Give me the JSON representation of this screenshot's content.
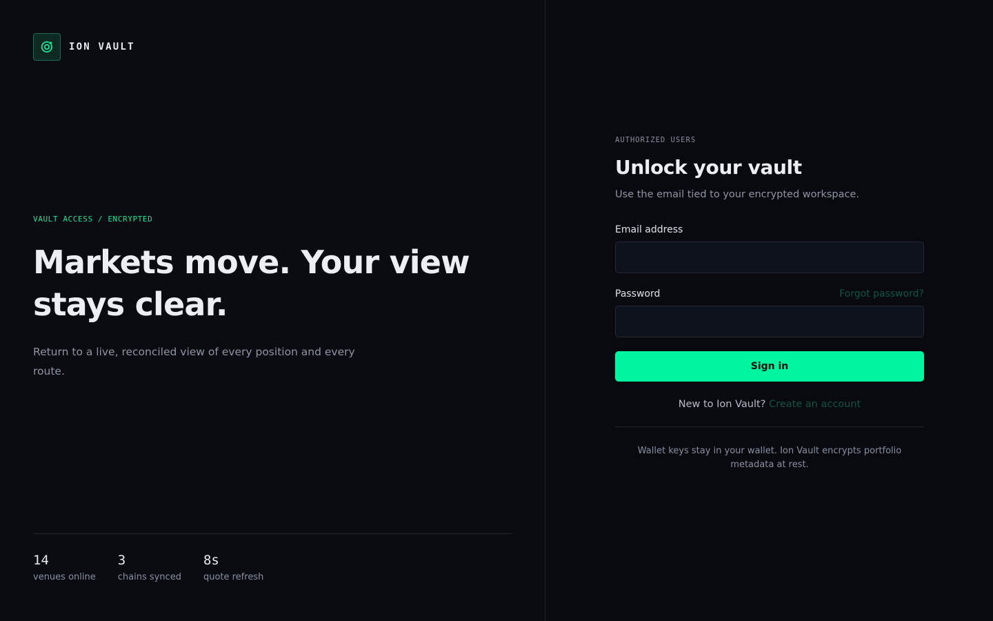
{
  "brand": {
    "name": "ION VAULT",
    "logo_icon": "atom-orbit-icon",
    "accent_color": "#00f5a0"
  },
  "hero": {
    "eyebrow": "VAULT ACCESS / ENCRYPTED",
    "headline": "Markets move. Your view stays clear.",
    "lead": "Return to a live, reconciled view of every position and every route."
  },
  "stats": [
    {
      "value": "14",
      "label": "venues online"
    },
    {
      "value": "3",
      "label": "chains synced"
    },
    {
      "value": "8s",
      "label": "quote refresh"
    }
  ],
  "form": {
    "kicker": "AUTHORIZED USERS",
    "title": "Unlock your vault",
    "subtitle": "Use the email tied to your encrypted workspace.",
    "email": {
      "label": "Email address",
      "value": "",
      "placeholder": ""
    },
    "password": {
      "label": "Password",
      "value": "",
      "placeholder": ""
    },
    "forgot_label": "Forgot password?",
    "submit_label": "Sign in",
    "signup_prompt": "New to Ion Vault?",
    "signup_link": "Create an account",
    "note": "Wallet keys stay in your wallet. Ion Vault encrypts portfolio metadata at rest."
  }
}
